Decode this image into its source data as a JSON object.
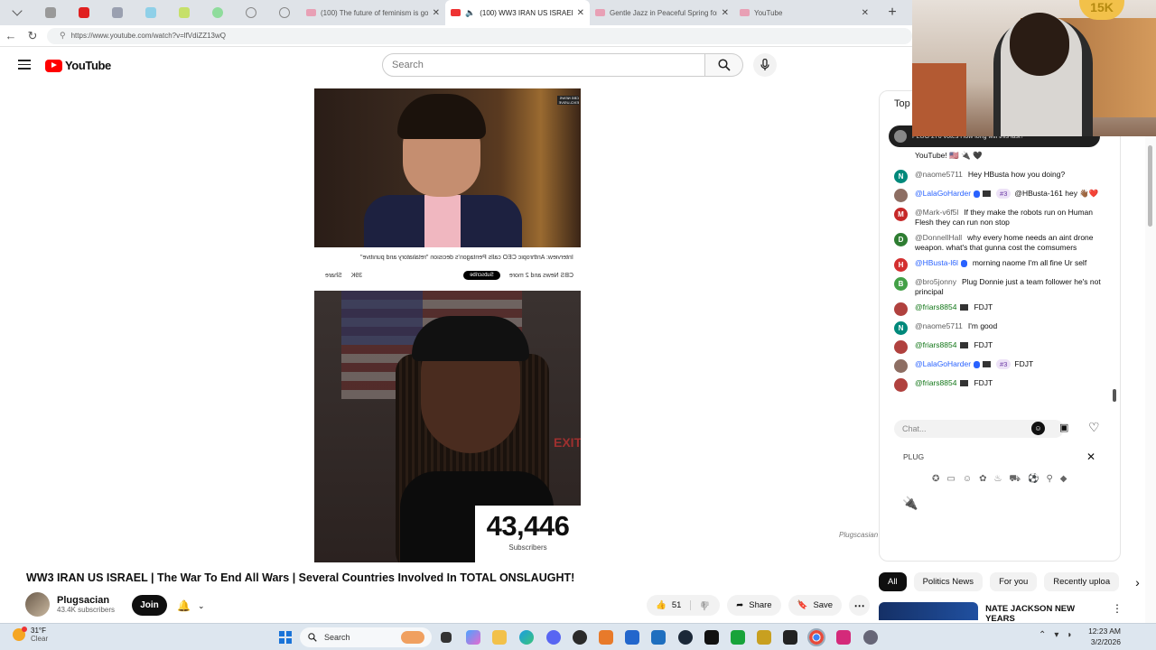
{
  "browser": {
    "tabs": [
      {
        "title": "(100) The future of feminism is go"
      },
      {
        "title": "(100) WW3 IRAN US ISRAEL |",
        "active": true
      },
      {
        "title": "Gentle Jazz in Peaceful Spring for"
      },
      {
        "title": "YouTube"
      }
    ],
    "new_tab": "+",
    "url": "https://www.youtube.com/watch?v=lfVdiZZ13wQ"
  },
  "youtube": {
    "logo_text": "YouTube",
    "search_placeholder": "Search"
  },
  "video": {
    "chyron_text": "Interview: Anthropic CEO calls Pentagon's decision \"retaliatory and punitive\"",
    "chyron_channel": "CBS News and 2 more",
    "chyron_subscribe": "Subscribe",
    "chyron_likes": "39K",
    "chyron_share": "Share",
    "chyron_logo": "CBS NEWS EXCLUSIVE",
    "exit_sign": "EXIT",
    "sub_counter": "43,446",
    "sub_counter_label": "Subscribers",
    "watermark": "Plugscasian"
  },
  "info": {
    "title": "WW3 IRAN US ISRAEL | The War To End All Wars | Several Countries Involved In TOTAL ONSLAUGHT!",
    "channel": "Plugsacian",
    "subscribers": "43.4K subscribers",
    "join": "Join",
    "likes": "51",
    "share": "Share",
    "save": "Save"
  },
  "chat": {
    "header": "Top",
    "pinned": "PLUG 270 votes  How long will this last?",
    "messages": [
      {
        "avatar": "",
        "color": "#ffffff",
        "user": "",
        "text": "YouTube! 🇺🇸 🔌 🖤"
      },
      {
        "avatar": "N",
        "color": "#00897b",
        "user": "@naome5711",
        "text": "Hey HBusta how you doing?"
      },
      {
        "avatar": "",
        "color": "#8d6e63",
        "user": "@LalaGoHarder",
        "badge": "#3",
        "text": "@HBusta-161 hey 👋🏾❤️"
      },
      {
        "avatar": "M",
        "color": "#c62828",
        "user": "@Mark-v6f5l",
        "text": "If they make the robots run on Human Flesh they can run non stop"
      },
      {
        "avatar": "D",
        "color": "#2e7d32",
        "user": "@DonnellHall",
        "text": "why every home needs an aint drone weapon. what's that gunna cost the comsumers"
      },
      {
        "avatar": "H",
        "color": "#d32f2f",
        "user": "@HBusta-l6l",
        "text": "morning naome I'm all fine Ur self"
      },
      {
        "avatar": "B",
        "color": "#43a047",
        "user": "@bro5jonny",
        "text": "Plug Donnie just a team follower he's not principal"
      },
      {
        "avatar": "",
        "color": "#b0413e",
        "user": "@friars8854",
        "text": "FDJT"
      },
      {
        "avatar": "N",
        "color": "#00897b",
        "user": "@naome5711",
        "text": "I'm good"
      },
      {
        "avatar": "",
        "color": "#b0413e",
        "user": "@friars8854",
        "text": "FDJT"
      },
      {
        "avatar": "",
        "color": "#8d6e63",
        "user": "@LalaGoHarder",
        "badge": "#3",
        "text": "FDJT"
      },
      {
        "avatar": "",
        "color": "#b0413e",
        "user": "@friars8854",
        "text": "FDJT"
      }
    ],
    "input_placeholder": "Chat...",
    "emoji_search": "PLUG",
    "emoji_pick": "🔌"
  },
  "chips": [
    "All",
    "Politics News",
    "For you",
    "Recently uploa"
  ],
  "recommended": {
    "title": "NATE JACKSON  NEW YEARS"
  },
  "webcam": {
    "balloon": "15K"
  },
  "taskbar": {
    "temp": "31°F",
    "condition": "Clear",
    "search": "Search",
    "time": "12:23 AM",
    "date": "3/2/2026"
  },
  "colors": {
    "yt_red": "#ff0000",
    "chat_blue": "#2962ff",
    "chat_green": "#107516"
  }
}
